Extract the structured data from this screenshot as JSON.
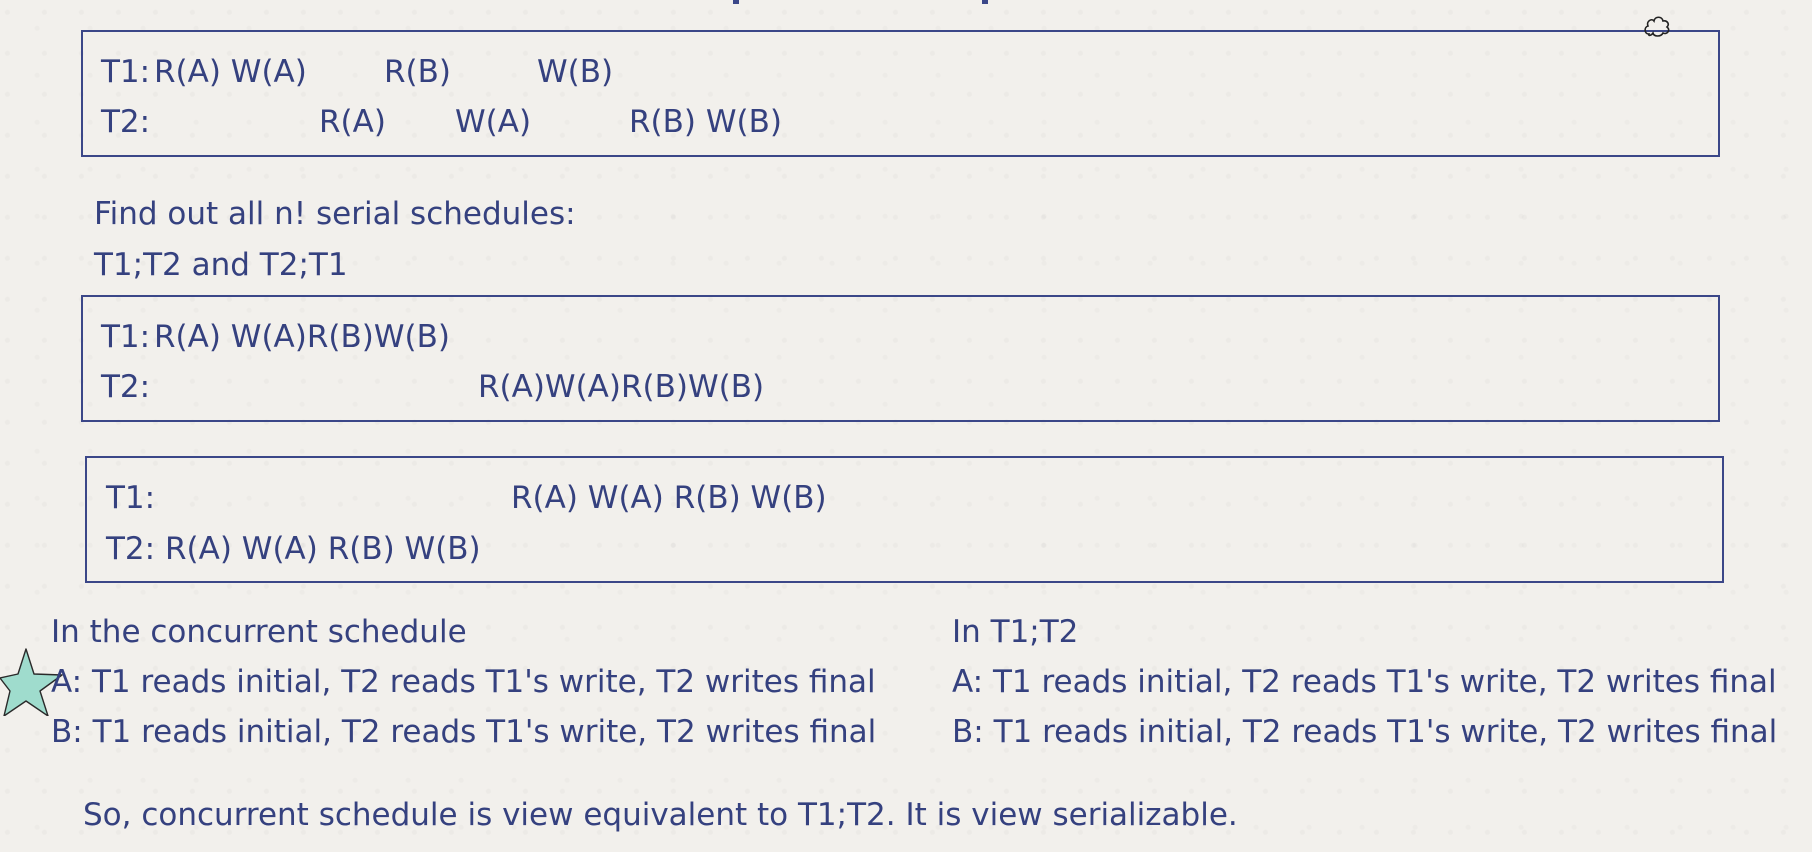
{
  "box1": {
    "t1_label": "T1:",
    "t1_ops": [
      "R(A) W(A)",
      "R(B)",
      "W(B)"
    ],
    "t2_label": "T2:",
    "t2_ops": [
      "R(A)",
      "W(A)",
      "R(B) W(B)"
    ]
  },
  "intro": {
    "line1": "Find out all n! serial schedules:",
    "line2": "T1;T2 and T2;T1"
  },
  "box2": {
    "t1_label": "T1:",
    "t1_ops": "R(A) W(A)R(B)W(B)",
    "t2_label": "T2:",
    "t2_ops": "R(A)W(A)R(B)W(B)"
  },
  "box3": {
    "t1_label": "T1:",
    "t1_ops": "R(A) W(A) R(B) W(B)",
    "t2_label": "T2:",
    "t2_ops": "R(A) W(A) R(B) W(B)"
  },
  "left_col": {
    "heading": "In the concurrent schedule",
    "a_line": "A: T1 reads initial, T2 reads T1's write, T2 writes final",
    "b_line": "B: T1 reads initial, T2 reads T1's write, T2 writes final"
  },
  "right_col": {
    "heading": "In T1;T2",
    "a_line": "A: T1 reads initial, T2 reads T1's write, T2 writes final",
    "b_line": "B: T1 reads initial, T2 reads T1's write, T2 writes final"
  },
  "conclusion": "So, concurrent schedule is view equivalent to T1;T2. It is view serializable.",
  "icons": {
    "star": "star-icon",
    "cloud": "cloud-icon"
  },
  "colors": {
    "ink": "#35417f",
    "star_fill": "#9fdccd",
    "background": "#f2f0ec"
  }
}
